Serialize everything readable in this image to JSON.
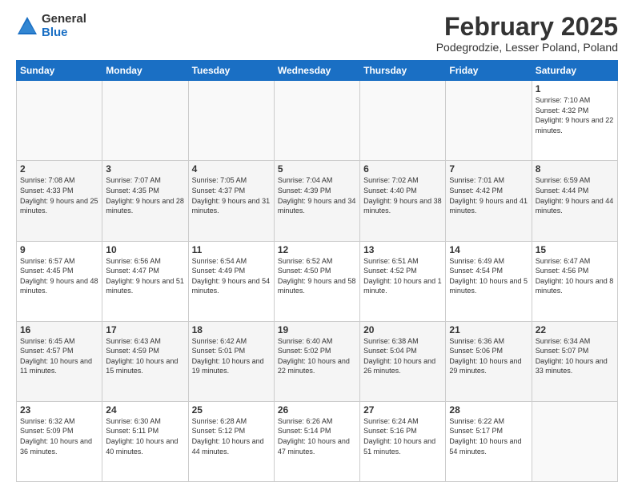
{
  "header": {
    "logo_general": "General",
    "logo_blue": "Blue",
    "month_title": "February 2025",
    "location": "Podegrodzie, Lesser Poland, Poland"
  },
  "days_of_week": [
    "Sunday",
    "Monday",
    "Tuesday",
    "Wednesday",
    "Thursday",
    "Friday",
    "Saturday"
  ],
  "weeks": [
    [
      {
        "num": "",
        "info": ""
      },
      {
        "num": "",
        "info": ""
      },
      {
        "num": "",
        "info": ""
      },
      {
        "num": "",
        "info": ""
      },
      {
        "num": "",
        "info": ""
      },
      {
        "num": "",
        "info": ""
      },
      {
        "num": "1",
        "info": "Sunrise: 7:10 AM\nSunset: 4:32 PM\nDaylight: 9 hours and 22 minutes."
      }
    ],
    [
      {
        "num": "2",
        "info": "Sunrise: 7:08 AM\nSunset: 4:33 PM\nDaylight: 9 hours and 25 minutes."
      },
      {
        "num": "3",
        "info": "Sunrise: 7:07 AM\nSunset: 4:35 PM\nDaylight: 9 hours and 28 minutes."
      },
      {
        "num": "4",
        "info": "Sunrise: 7:05 AM\nSunset: 4:37 PM\nDaylight: 9 hours and 31 minutes."
      },
      {
        "num": "5",
        "info": "Sunrise: 7:04 AM\nSunset: 4:39 PM\nDaylight: 9 hours and 34 minutes."
      },
      {
        "num": "6",
        "info": "Sunrise: 7:02 AM\nSunset: 4:40 PM\nDaylight: 9 hours and 38 minutes."
      },
      {
        "num": "7",
        "info": "Sunrise: 7:01 AM\nSunset: 4:42 PM\nDaylight: 9 hours and 41 minutes."
      },
      {
        "num": "8",
        "info": "Sunrise: 6:59 AM\nSunset: 4:44 PM\nDaylight: 9 hours and 44 minutes."
      }
    ],
    [
      {
        "num": "9",
        "info": "Sunrise: 6:57 AM\nSunset: 4:45 PM\nDaylight: 9 hours and 48 minutes."
      },
      {
        "num": "10",
        "info": "Sunrise: 6:56 AM\nSunset: 4:47 PM\nDaylight: 9 hours and 51 minutes."
      },
      {
        "num": "11",
        "info": "Sunrise: 6:54 AM\nSunset: 4:49 PM\nDaylight: 9 hours and 54 minutes."
      },
      {
        "num": "12",
        "info": "Sunrise: 6:52 AM\nSunset: 4:50 PM\nDaylight: 9 hours and 58 minutes."
      },
      {
        "num": "13",
        "info": "Sunrise: 6:51 AM\nSunset: 4:52 PM\nDaylight: 10 hours and 1 minute."
      },
      {
        "num": "14",
        "info": "Sunrise: 6:49 AM\nSunset: 4:54 PM\nDaylight: 10 hours and 5 minutes."
      },
      {
        "num": "15",
        "info": "Sunrise: 6:47 AM\nSunset: 4:56 PM\nDaylight: 10 hours and 8 minutes."
      }
    ],
    [
      {
        "num": "16",
        "info": "Sunrise: 6:45 AM\nSunset: 4:57 PM\nDaylight: 10 hours and 11 minutes."
      },
      {
        "num": "17",
        "info": "Sunrise: 6:43 AM\nSunset: 4:59 PM\nDaylight: 10 hours and 15 minutes."
      },
      {
        "num": "18",
        "info": "Sunrise: 6:42 AM\nSunset: 5:01 PM\nDaylight: 10 hours and 19 minutes."
      },
      {
        "num": "19",
        "info": "Sunrise: 6:40 AM\nSunset: 5:02 PM\nDaylight: 10 hours and 22 minutes."
      },
      {
        "num": "20",
        "info": "Sunrise: 6:38 AM\nSunset: 5:04 PM\nDaylight: 10 hours and 26 minutes."
      },
      {
        "num": "21",
        "info": "Sunrise: 6:36 AM\nSunset: 5:06 PM\nDaylight: 10 hours and 29 minutes."
      },
      {
        "num": "22",
        "info": "Sunrise: 6:34 AM\nSunset: 5:07 PM\nDaylight: 10 hours and 33 minutes."
      }
    ],
    [
      {
        "num": "23",
        "info": "Sunrise: 6:32 AM\nSunset: 5:09 PM\nDaylight: 10 hours and 36 minutes."
      },
      {
        "num": "24",
        "info": "Sunrise: 6:30 AM\nSunset: 5:11 PM\nDaylight: 10 hours and 40 minutes."
      },
      {
        "num": "25",
        "info": "Sunrise: 6:28 AM\nSunset: 5:12 PM\nDaylight: 10 hours and 44 minutes."
      },
      {
        "num": "26",
        "info": "Sunrise: 6:26 AM\nSunset: 5:14 PM\nDaylight: 10 hours and 47 minutes."
      },
      {
        "num": "27",
        "info": "Sunrise: 6:24 AM\nSunset: 5:16 PM\nDaylight: 10 hours and 51 minutes."
      },
      {
        "num": "28",
        "info": "Sunrise: 6:22 AM\nSunset: 5:17 PM\nDaylight: 10 hours and 54 minutes."
      },
      {
        "num": "",
        "info": ""
      }
    ]
  ]
}
